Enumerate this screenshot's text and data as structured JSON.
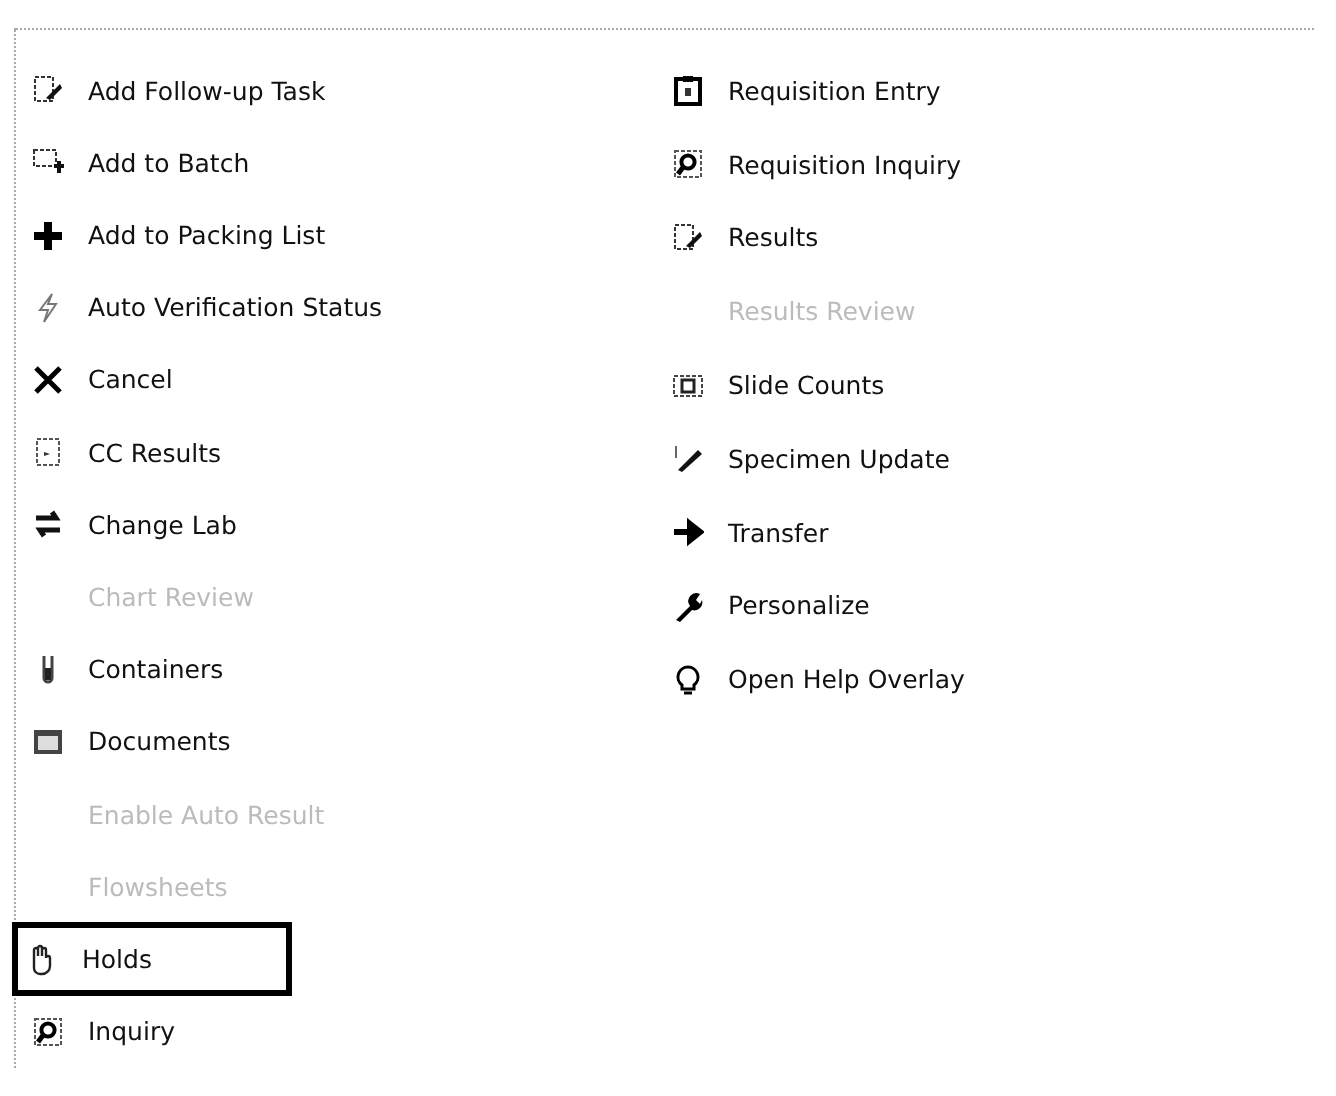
{
  "columns": [
    {
      "items": [
        {
          "label": "Add Follow-up Task",
          "kind": "task",
          "disabled": false,
          "selected": false
        },
        {
          "label": "Add to Batch",
          "kind": "batch",
          "disabled": false,
          "selected": false
        },
        {
          "label": "Add to Packing List",
          "kind": "plus",
          "disabled": false,
          "selected": false
        },
        {
          "label": "Auto Verification Status",
          "kind": "bolt",
          "disabled": false,
          "selected": false
        },
        {
          "label": "Cancel",
          "kind": "cross",
          "disabled": false,
          "selected": false
        },
        {
          "label": "CC Results",
          "kind": "doc",
          "disabled": false,
          "selected": false
        },
        {
          "label": "Change Lab",
          "kind": "swap",
          "disabled": false,
          "selected": false
        },
        {
          "label": "Chart Review",
          "kind": "none",
          "disabled": true,
          "selected": false
        },
        {
          "label": "Containers",
          "kind": "tube",
          "disabled": false,
          "selected": false
        },
        {
          "label": "Documents",
          "kind": "docs",
          "disabled": false,
          "selected": false
        },
        {
          "label": "Enable Auto Result",
          "kind": "none",
          "disabled": true,
          "selected": false
        },
        {
          "label": "Flowsheets",
          "kind": "none",
          "disabled": true,
          "selected": false
        },
        {
          "label": "Holds",
          "kind": "hand",
          "disabled": false,
          "selected": true
        },
        {
          "label": "Inquiry",
          "kind": "search",
          "disabled": false,
          "selected": false
        }
      ]
    },
    {
      "items": [
        {
          "label": "Requisition Entry",
          "kind": "clipboard",
          "disabled": false,
          "selected": false
        },
        {
          "label": "Requisition Inquiry",
          "kind": "search",
          "disabled": false,
          "selected": false
        },
        {
          "label": "Results",
          "kind": "task",
          "disabled": false,
          "selected": false
        },
        {
          "label": "Results Review",
          "kind": "none",
          "disabled": true,
          "selected": false
        },
        {
          "label": "Slide Counts",
          "kind": "slide",
          "disabled": false,
          "selected": false
        },
        {
          "label": "Specimen Update",
          "kind": "pen",
          "disabled": false,
          "selected": false
        },
        {
          "label": "Transfer",
          "kind": "arrow",
          "disabled": false,
          "selected": false
        },
        {
          "label": "Personalize",
          "kind": "wrench",
          "disabled": false,
          "selected": false
        },
        {
          "label": "Open Help Overlay",
          "kind": "bulb",
          "disabled": false,
          "selected": false
        }
      ]
    }
  ]
}
